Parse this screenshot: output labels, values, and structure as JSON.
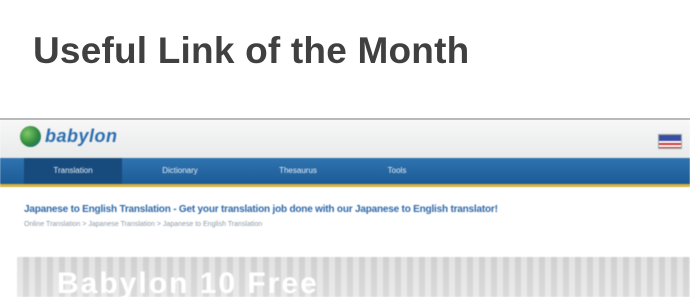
{
  "slide": {
    "title": "Useful Link of the Month"
  },
  "site": {
    "logo_text": "babylon",
    "flag_icon": "us-flag-icon",
    "nav_tabs": [
      {
        "label": "Translation",
        "active": true
      },
      {
        "label": "Dictionary",
        "active": false
      },
      {
        "label": "Thesaurus",
        "active": false
      },
      {
        "label": "Tools",
        "active": false
      }
    ],
    "headline": "Japanese to English Translation - Get your translation job done with our Japanese to English translator!",
    "breadcrumbs": "Online Translation > Japanese Translation > Japanese to English Translation",
    "hero_text": "Babylon 10 Free"
  }
}
